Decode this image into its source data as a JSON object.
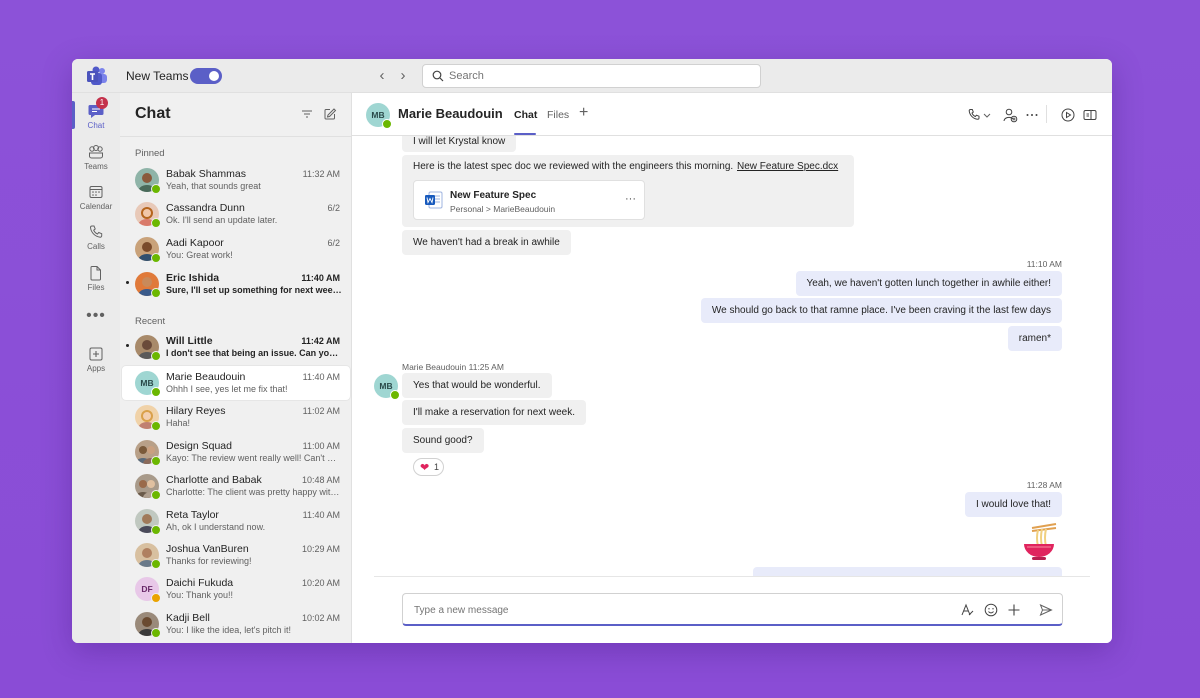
{
  "app": {
    "new_teams_label": "New Teams",
    "new_teams_enabled": true,
    "accent_color": "#5b5fc7",
    "background_color": "#8a4fd8"
  },
  "search": {
    "placeholder": "Search"
  },
  "rail": {
    "items": [
      {
        "label": "Chat",
        "icon": "chat-icon",
        "active": true,
        "badge": "1"
      },
      {
        "label": "Teams",
        "icon": "teams-icon"
      },
      {
        "label": "Calendar",
        "icon": "calendar-icon"
      },
      {
        "label": "Calls",
        "icon": "phone-icon"
      },
      {
        "label": "Files",
        "icon": "file-icon"
      },
      {
        "label": "Apps",
        "icon": "apps-plus-icon"
      }
    ],
    "more": "•••"
  },
  "chatlist": {
    "title": "Chat",
    "pinned_label": "Pinned",
    "recent_label": "Recent",
    "pinned": [
      {
        "name": "Babak Shammas",
        "time": "11:32 AM",
        "preview": "Yeah, that sounds great",
        "unread": false
      },
      {
        "name": "Cassandra Dunn",
        "time": "6/2",
        "preview": "Ok. I'll send an update later.",
        "unread": false
      },
      {
        "name": "Aadi Kapoor",
        "time": "6/2",
        "preview": "You: Great work!",
        "unread": false
      },
      {
        "name": "Eric Ishida",
        "time": "11:40 AM",
        "preview": "Sure, I'll set up something for next week t...",
        "unread": true
      }
    ],
    "recent": [
      {
        "name": "Will Little",
        "time": "11:42 AM",
        "preview": "I don't see that being an issue. Can you ta...",
        "unread": true
      },
      {
        "name": "Marie Beaudouin",
        "initials": "MB",
        "time": "11:40 AM",
        "preview": "Ohhh I see, yes let me fix that!",
        "selected": true
      },
      {
        "name": "Hilary Reyes",
        "time": "11:02 AM",
        "preview": "Haha!"
      },
      {
        "name": "Design Squad",
        "time": "11:00 AM",
        "preview": "Kayo: The review went really well! Can't wai..."
      },
      {
        "name": "Charlotte and Babak",
        "time": "10:48 AM",
        "preview": "Charlotte: The client was pretty happy with..."
      },
      {
        "name": "Reta Taylor",
        "time": "11:40 AM",
        "preview": "Ah, ok I understand now."
      },
      {
        "name": "Joshua VanBuren",
        "time": "10:29 AM",
        "preview": "Thanks for reviewing!"
      },
      {
        "name": "Daichi Fukuda",
        "initials": "DF",
        "time": "10:20 AM",
        "preview": "You: Thank you!!",
        "presence": "away"
      },
      {
        "name": "Kadji Bell",
        "time": "10:02 AM",
        "preview": "You: I like the idea, let's pitch it!"
      }
    ]
  },
  "conversation": {
    "contact_name": "Marie Beaudouin",
    "contact_initials": "MB",
    "tabs": [
      "Chat",
      "Files"
    ],
    "messages": {
      "m1": "I will let Krystal know",
      "m2_text": "Here is the latest spec doc we reviewed with the engineers this morning.",
      "m2_link": "New Feature Spec.dcx",
      "file_name": "New Feature Spec",
      "file_path": "Personal > MarieBeaudouin",
      "file_more": "···",
      "m3": "We haven't had a break in awhile",
      "time1": "11:10 AM",
      "m4": "Yeah, we haven't gotten lunch together in awhile either!",
      "m5": "We should go back to that ramne place. I've been craving it the last few days",
      "m6": "ramen*",
      "meta2": "Marie Beaudouin 11:25 AM",
      "m7": "Yes that would be wonderful.",
      "m8": "I'll make a reservation for next week.",
      "m9": "Sound good?",
      "reaction_count": "1",
      "time2": "11:28 AM",
      "m10": "I would love that!"
    },
    "compose_placeholder": "Type a new message"
  }
}
